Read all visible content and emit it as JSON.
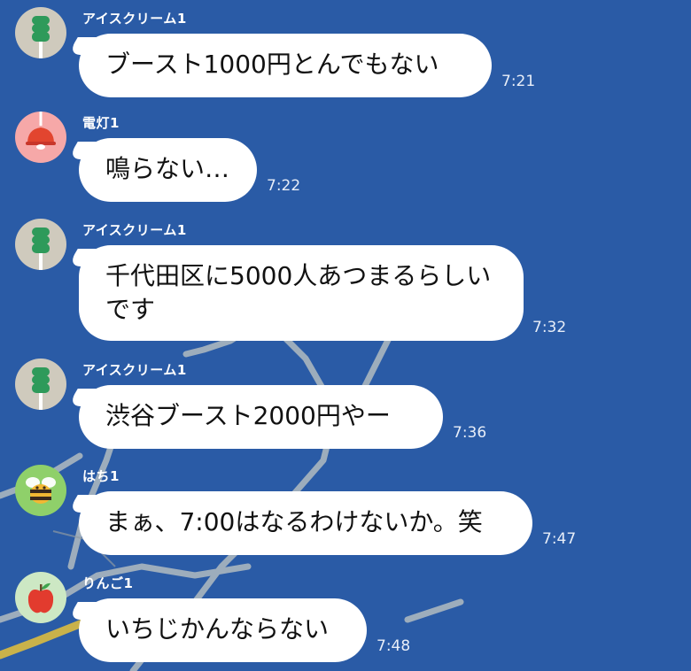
{
  "chat": {
    "messages": [
      {
        "sender": "アイスクリーム1",
        "avatar": "ice-cream-icon",
        "avatar_bg": "#cfcabd",
        "text": "ブースト1000円とんでもない",
        "time": "7:21"
      },
      {
        "sender": "電灯1",
        "avatar": "lamp-icon",
        "avatar_bg": "#f6a8a8",
        "text": "鳴らない…",
        "time": "7:22"
      },
      {
        "sender": "アイスクリーム1",
        "avatar": "ice-cream-icon",
        "avatar_bg": "#cfcabd",
        "text": "千代田区に5000人あつまるらしいです",
        "time": "7:32"
      },
      {
        "sender": "アイスクリーム1",
        "avatar": "ice-cream-icon",
        "avatar_bg": "#cfcabd",
        "text": "渋谷ブースト2000円やー",
        "time": "7:36"
      },
      {
        "sender": "はち1",
        "avatar": "bee-icon",
        "avatar_bg": "#8fd06a",
        "text": "まぁ、7:00はなるわけないか。笑",
        "time": "7:47"
      },
      {
        "sender": "りんご1",
        "avatar": "apple-icon",
        "avatar_bg": "#cde8c4",
        "text": "いちじかんならない",
        "time": "7:48"
      }
    ]
  },
  "colors": {
    "background": "#2a5ba6",
    "bubble": "#ffffff",
    "map_road": "#b8c2c8",
    "map_road_yellow": "#c9b24a"
  }
}
